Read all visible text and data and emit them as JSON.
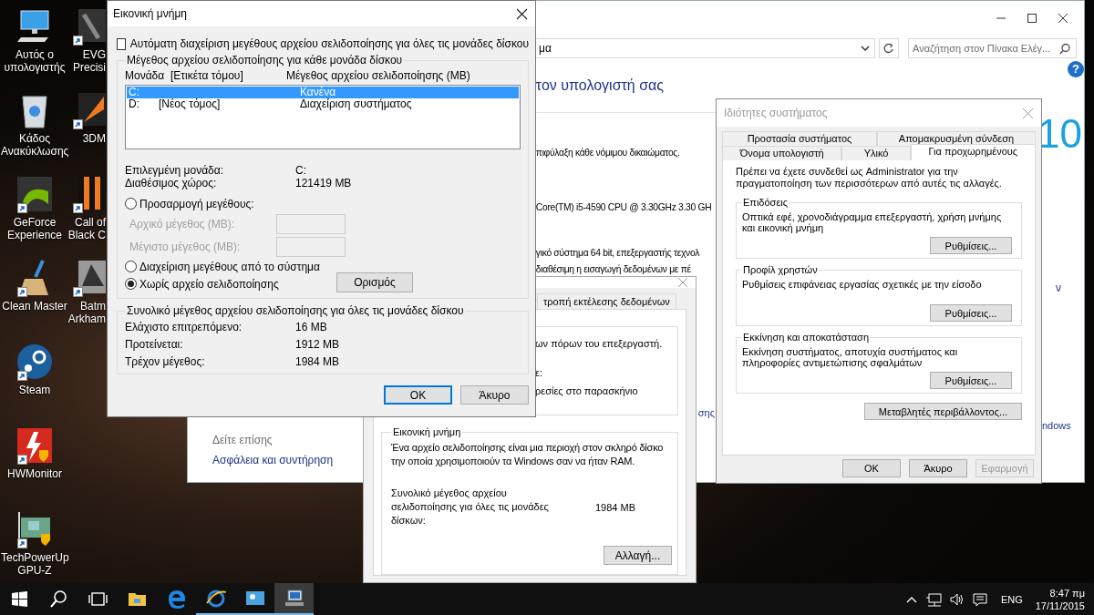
{
  "desktop": {
    "icons": [
      {
        "kind": "computer",
        "label": "Αυτός ο υπολογιστής",
        "shortcut": false
      },
      {
        "kind": "recycle-bin",
        "label": "Κάδος Ανακύκλωσης",
        "shortcut": false
      },
      {
        "kind": "nvidia",
        "label": "GeForce Experience",
        "shortcut": true
      },
      {
        "kind": "broom",
        "label": "Clean Master",
        "shortcut": true
      },
      {
        "kind": "steam",
        "label": "Steam",
        "shortcut": true
      },
      {
        "kind": "hwmonitor",
        "label": "HWMonitor",
        "shortcut": true
      },
      {
        "kind": "gpuz",
        "label": "TechPowerUp GPU-Z",
        "shortcut": true
      }
    ],
    "partial_icons": [
      {
        "kind": "evga",
        "lines": [
          "EVG",
          "Precisi"
        ],
        "shortcut": true
      },
      {
        "kind": "benchmark",
        "lines": [
          "3DM"
        ],
        "shortcut": true
      },
      {
        "kind": "game",
        "lines": [
          "Call of",
          "Black C"
        ],
        "shortcut": true
      },
      {
        "kind": "batman",
        "lines": [
          "Batm",
          "Arkham"
        ],
        "shortcut": true
      }
    ]
  },
  "control_panel": {
    "address": "μα",
    "search": {
      "placeholder": "Αναζήτηση στον Πίνακα Ελέγ..."
    },
    "heading": "τον υπολογιστή σας",
    "lines": [
      "πιφύλαξη κάθε νόμιμου δικαιώματος.",
      "Core(TM) i5-4590 CPU @ 3.30GHz 3.30 GH",
      "γικό σύστημα 64 bit, επεξεργαστής τεχνολ",
      "διαθέσιμη η εισαγωγή δεδομένων με πέ"
    ],
    "link_fragment": "σης",
    "edition": "10",
    "help": "?",
    "right_fragments": [
      "ν",
      "ndows"
    ],
    "see_also": {
      "title": "Δείτε επίσης",
      "links": [
        "Ασφάλεια και συντήρηση"
      ]
    }
  },
  "performance_options": {
    "tab": "τροπή εκτέλεσης δεδομένων",
    "group_lines": [
      "ων πόρων του επεξεργαστή.",
      "ε:",
      "ρεσίες στο παρασκήνιο"
    ],
    "virtual_memory": {
      "title": "Εικονική μνήμη",
      "description": "Ένα αρχείο σελιδοποίησης είναι μια περιοχή στον σκληρό δίσκο την οποία χρησιμοποιούν τα Windows σαν να ήταν RAM.",
      "total_label": "Συνολικό μέγεθος αρχείου σελιδοποίησης για όλες τις μονάδες δίσκων:",
      "total_value": "1984 MB",
      "button": "Αλλαγή..."
    }
  },
  "system_properties": {
    "title": "Ιδιότητες συστήματος",
    "active": false,
    "tab_rows": [
      {
        "tabs": [
          {
            "label": "Προστασία συστήματος",
            "selected": false
          },
          {
            "label": "Απομακρυσμένη σύνδεση",
            "selected": false
          }
        ]
      },
      {
        "tabs": [
          {
            "label": "Όνομα υπολογιστή",
            "selected": false
          },
          {
            "label": "Υλικό",
            "selected": false
          },
          {
            "label": "Για προχωρημένους",
            "selected": true
          }
        ]
      }
    ],
    "notice": "Πρέπει να έχετε συνδεθεί ως Administrator για την πραγματοποίηση των περισσότερων από αυτές τις αλλαγές.",
    "groups": [
      {
        "title": "Επιδόσεις",
        "description": "Οπτικά εφέ, χρονοδιάγραμμα επεξεργαστή, χρήση μνήμης και εικονική μνήμη",
        "button": "Ρυθμίσεις..."
      },
      {
        "title": "Προφίλ χρηστών",
        "description": "Ρυθμίσεις επιφάνειας εργασίας σχετικές με την είσοδο",
        "button": "Ρυθμίσεις..."
      },
      {
        "title": "Εκκίνηση και αποκατάσταση",
        "description": "Εκκίνηση συστήματος, αποτυχία συστήματος και πληροφορίες αντιμετώπισης σφαλμάτων",
        "button": "Ρυθμίσεις..."
      }
    ],
    "environment_button": "Μεταβλητές περιβάλλοντος...",
    "buttons": [
      {
        "label": "OK",
        "disabled": false
      },
      {
        "label": "Άκυρο",
        "disabled": false
      },
      {
        "label": "Εφαρμογή",
        "disabled": true
      }
    ]
  },
  "virtual_memory_dialog": {
    "title": "Εικονική μνήμη",
    "auto_manage": {
      "label": "Αυτόματη διαχείριση μεγέθους αρχείου σελιδοποίησης για όλες τις μονάδες δίσκου",
      "checked": false
    },
    "drives_group": {
      "title": "Μέγεθος αρχείου σελιδοποίησης για κάθε μονάδα δίσκου",
      "columns": [
        "Μονάδα  [Ετικέτα τόμου]",
        "Μέγεθος αρχείου σελιδοποίησης (MB)"
      ],
      "rows": [
        {
          "drive": "C:",
          "size": "Κανένα",
          "selected": true
        },
        {
          "drive": "D:",
          "label": "[Νέος τόμος]",
          "size": "Διαχείριση συστήματος",
          "selected": false
        }
      ],
      "info": [
        {
          "label": "Επιλεγμένη μονάδα:",
          "value": "C:"
        },
        {
          "label": "Διαθέσιμος χώρος:",
          "value": "121419 MB"
        }
      ],
      "options": [
        {
          "label": "Προσαρμογή μεγέθους:",
          "selected": false,
          "fields": [
            {
              "label": "Αρχικό μέγεθος (MB):",
              "disabled": true
            },
            {
              "label": "Μέγιστο μέγεθος (MB):",
              "disabled": true
            }
          ]
        },
        {
          "label": "Διαχείριση μεγέθους από το σύστημα",
          "selected": false
        },
        {
          "label": "Χωρίς αρχείο σελιδοποίησης",
          "selected": true
        }
      ],
      "set_button": "Ορισμός"
    },
    "totals_group": {
      "title": "Συνολικό μέγεθος αρχείου σελιδοποίησης για όλες τις μονάδες δίσκου",
      "rows": [
        {
          "label": "Ελάχιστο επιτρεπόμενο:",
          "value": "16 MB"
        },
        {
          "label": "Προτείνεται:",
          "value": "1912 MB"
        },
        {
          "label": "Τρέχον μέγεθος:",
          "value": "1984 MB"
        }
      ]
    },
    "buttons": [
      {
        "label": "OK",
        "default": true
      },
      {
        "label": "Άκυρο",
        "default": false
      }
    ]
  },
  "taskbar": {
    "buttons": [
      {
        "kind": "start",
        "running": false,
        "selected": false
      },
      {
        "kind": "search",
        "running": false,
        "selected": false
      },
      {
        "kind": "task-view",
        "running": false,
        "selected": false
      },
      {
        "kind": "folder",
        "running": false,
        "selected": false
      },
      {
        "kind": "edge",
        "running": false,
        "selected": false
      },
      {
        "kind": "ie",
        "running": true,
        "selected": false
      },
      {
        "kind": "app",
        "running": true,
        "selected": false
      },
      {
        "kind": "system-app",
        "running": true,
        "selected": true
      }
    ],
    "tray": {
      "language": "ENG",
      "time": "8:47 πμ",
      "date": "17/11/2015"
    }
  }
}
